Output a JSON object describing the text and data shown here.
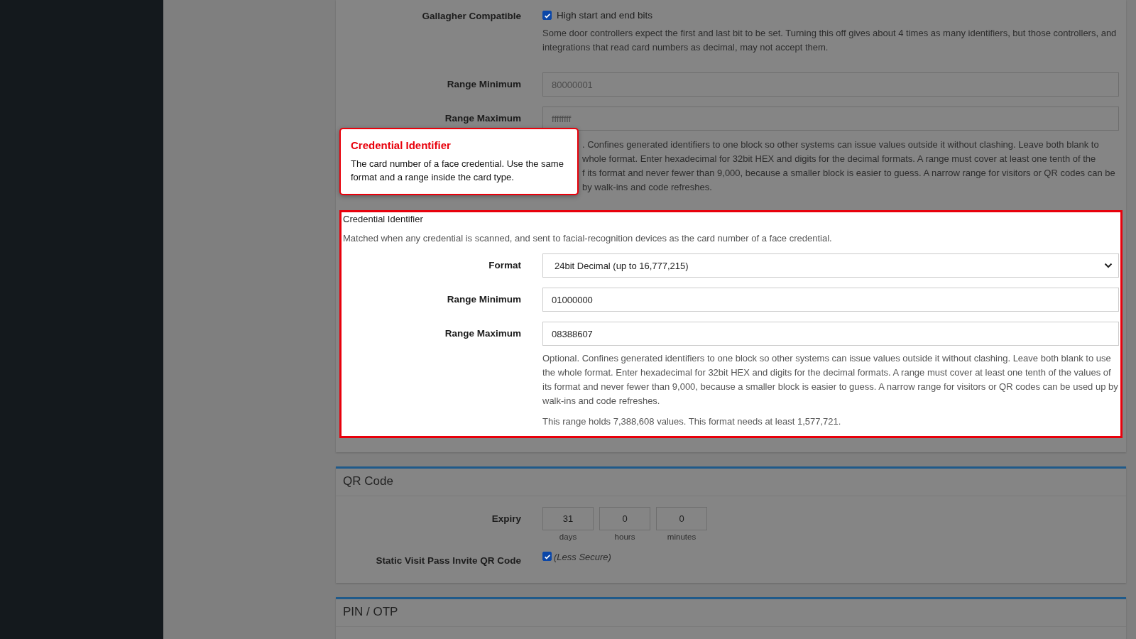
{
  "card_section": {
    "gallagher": {
      "label": "Gallagher Compatible",
      "checkbox_label": "High start and end bits",
      "checked": true,
      "help": "Some door controllers expect the first and last bit to be set. Turning this off gives about 4 times as many identifiers, but those controllers, and integrations that read card numbers as decimal, may not accept them."
    },
    "range_minimum": {
      "label": "Range Minimum",
      "placeholder": "80000001"
    },
    "range_maximum": {
      "label": "Range Maximum",
      "placeholder": "ffffffff"
    },
    "help_visible_lines": [
      ". Confines generated identifiers to one block so other systems can issue values outside it without clashing. Leave both blank to",
      "whole format. Enter hexadecimal for 32bit HEX and digits for the decimal formats. A range must cover at least one tenth of the",
      "f its format and never fewer than 9,000, because a smaller block is easier to guess. A narrow range for visitors or QR codes can be",
      "by walk-ins and code refreshes."
    ]
  },
  "tooltip": {
    "title": "Credential Identifier",
    "text": "The card number of a face credential. Use the same format and a range inside the card type."
  },
  "credential_identifier": {
    "title": "Credential Identifier",
    "description": "Matched when any credential is scanned, and sent to facial-recognition devices as the card number of a face credential.",
    "format": {
      "label": "Format",
      "value": "24bit Decimal (up to 16,777,215)"
    },
    "range_minimum": {
      "label": "Range Minimum",
      "value": "01000000"
    },
    "range_maximum": {
      "label": "Range Maximum",
      "value": "08388607"
    },
    "help": "Optional. Confines generated identifiers to one block so other systems can issue values outside it without clashing. Leave both blank to use the whole format. Enter hexadecimal for 32bit HEX and digits for the decimal formats. A range must cover at least one tenth of the values of its format and never fewer than 9,000, because a smaller block is easier to guess. A narrow range for visitors or QR codes can be used up by walk-ins and code refreshes.",
    "summary": "This range holds 7,388,608 values. This format needs at least 1,577,721."
  },
  "qr_code": {
    "title": "QR Code",
    "expiry": {
      "label": "Expiry",
      "fields": [
        {
          "value": "31",
          "unit": "days"
        },
        {
          "value": "0",
          "unit": "hours"
        },
        {
          "value": "0",
          "unit": "minutes"
        }
      ]
    },
    "static_invite": {
      "label": "Static Visit Pass Invite QR Code",
      "checked": true,
      "note": "(Less Secure)"
    }
  },
  "pin_otp": {
    "title": "PIN / OTP"
  }
}
